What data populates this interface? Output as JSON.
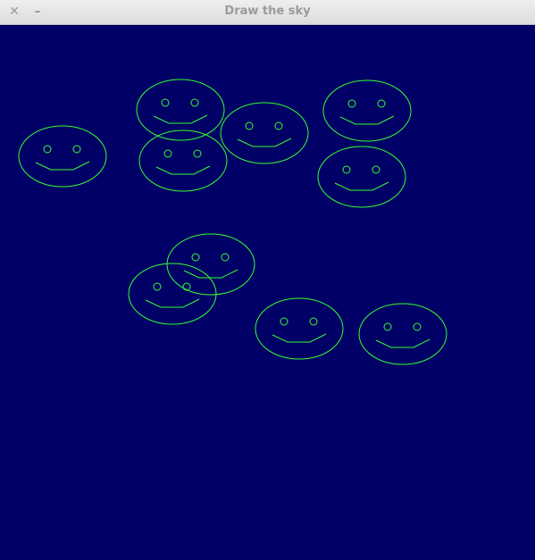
{
  "window": {
    "title": "Draw the sky",
    "close_glyph": "✕",
    "minimize_glyph": "–"
  },
  "canvas": {
    "background": "#000066",
    "stroke": "#33ff33",
    "smiley_count": 10
  }
}
